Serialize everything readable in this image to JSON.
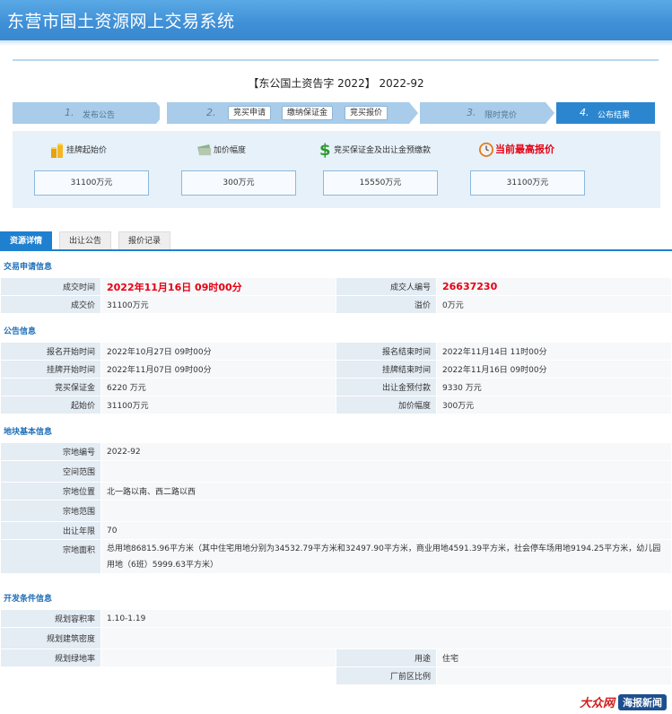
{
  "header": {
    "title": "东营市国土资源网上交易系统"
  },
  "notice_title": "【东公国土资告字 2022】 2022-92",
  "steps": {
    "s1_num": "1.",
    "s1_label": "发布公告",
    "s2_num": "2.",
    "s2_btn1": "竞买申请",
    "s2_btn2": "缴纳保证金",
    "s2_btn3": "竞买报价",
    "s3_num": "3.",
    "s3_label": "限时竞价",
    "s4_num": "4.",
    "s4_label": "公布结果"
  },
  "prices": {
    "start_label": "挂牌起始价",
    "start_value": "31100万元",
    "increment_label": "加价幅度",
    "increment_value": "300万元",
    "deposit_label": "竞买保证金及出让金预缴款",
    "deposit_value": "15550万元",
    "highest_label": "当前最高报价",
    "highest_value": "31100万元"
  },
  "tabs": {
    "t1": "资源详情",
    "t2": "出让公告",
    "t3": "报价记录"
  },
  "deal": {
    "heading": "交易申请信息",
    "time_label": "成交时间",
    "time_value": "2022年11月16日 09时00分",
    "buyer_label": "成交人编号",
    "buyer_value": "26637230",
    "price_label": "成交价",
    "price_value": "31100万元",
    "premium_label": "溢价",
    "premium_value": "0万元"
  },
  "notice": {
    "heading": "公告信息",
    "apply_start_label": "报名开始时间",
    "apply_start_value": "2022年10月27日 09时00分",
    "apply_end_label": "报名结束时间",
    "apply_end_value": "2022年11月14日 11时00分",
    "list_start_label": "挂牌开始时间",
    "list_start_value": "2022年11月07日 09时00分",
    "list_end_label": "挂牌结束时间",
    "list_end_value": "2022年11月16日 09时00分",
    "deposit_label": "竞买保证金",
    "deposit_value": "6220 万元",
    "prepay_label": "出让金预付款",
    "prepay_value": "9330 万元",
    "start_label": "起始价",
    "start_value": "31100万元",
    "inc_label": "加价幅度",
    "inc_value": "300万元"
  },
  "parcel": {
    "heading": "地块基本信息",
    "id_label": "宗地编号",
    "id_value": "2022-92",
    "space_label": "空间范围",
    "loc_label": "宗地位置",
    "loc_value": "北一路以南、西二路以西",
    "range_label": "宗地范围",
    "years_label": "出让年限",
    "years_value": "70",
    "area_label": "宗地面积",
    "area_value": "总用地86815.96平方米（其中住宅用地分别为34532.79平方米和32497.90平方米，商业用地4591.39平方米，社会停车场用地9194.25平方米，幼儿园用地（6班）5999.63平方米）"
  },
  "dev": {
    "heading": "开发条件信息",
    "far_label": "规划容积率",
    "far_value": "1.10-1.19",
    "density_label": "规划建筑密度",
    "green_label": "规划绿地率",
    "use_label": "用途",
    "use_value": "住宅",
    "plant_label": "厂前区比例"
  },
  "watermark": {
    "brand1": "大众网",
    "brand2": "海报新闻"
  },
  "colors": {
    "header": "#3e8fd6",
    "accent": "#1f80d0",
    "highlight": "#e60012"
  }
}
